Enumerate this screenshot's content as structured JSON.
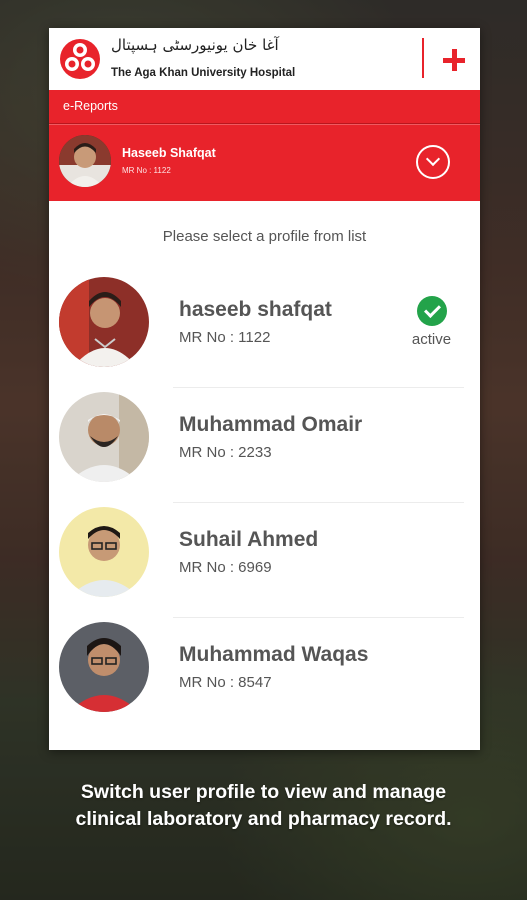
{
  "header": {
    "brand_urdu": "آغا خان یونیورسٹی ہسپتال",
    "brand_name": "The Aga Khan University Hospital",
    "plus_icon": "plus-icon",
    "accent_color": "#e8232b"
  },
  "subheader": {
    "title": "e-Reports"
  },
  "current_user": {
    "name": "Haseeb Shafqat",
    "mr": "MR No : 1122",
    "chevron_icon": "chevron-down-icon"
  },
  "prompt": "Please select a profile from list",
  "profiles": [
    {
      "name": "haseeb shafqat",
      "mr": "MR No : 1122",
      "status": "active"
    },
    {
      "name": "Muhammad Omair",
      "mr": "MR No : 2233"
    },
    {
      "name": "Suhail Ahmed",
      "mr": "MR No : 6969"
    },
    {
      "name": "Muhammad Waqas",
      "mr": "MR No : 8547"
    }
  ],
  "caption": {
    "line1": "Switch user profile to view and  manage",
    "line2": "clinical laboratory and pharmacy record."
  }
}
